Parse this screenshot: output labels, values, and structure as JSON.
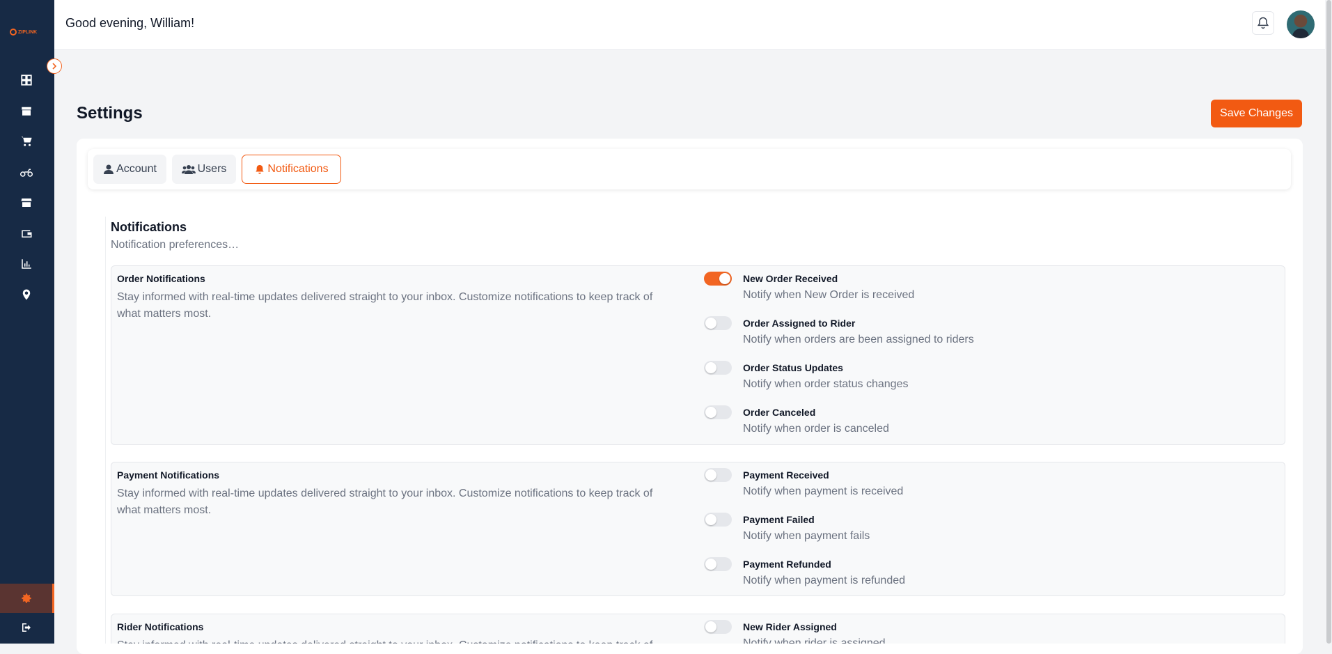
{
  "sidebar": {
    "logo_text": "ZIPLINK",
    "items": [
      {
        "icon": "dashboard-icon"
      },
      {
        "icon": "package-icon"
      },
      {
        "icon": "cart-icon"
      },
      {
        "icon": "motorbike-icon"
      },
      {
        "icon": "store-icon"
      },
      {
        "icon": "wallet-icon"
      },
      {
        "icon": "chart-icon"
      },
      {
        "icon": "location-pin-icon"
      }
    ],
    "settings_icon": "gear-icon",
    "logout_icon": "logout-icon",
    "accent": "#f26522",
    "background": "#172a45"
  },
  "header": {
    "greeting": "Good evening, William!"
  },
  "page": {
    "title": "Settings",
    "save_label": "Save Changes"
  },
  "tabs": [
    {
      "label": "Account",
      "icon": "user-icon"
    },
    {
      "label": "Users",
      "icon": "users-icon"
    },
    {
      "label": "Notifications",
      "icon": "bell-icon",
      "active": true
    }
  ],
  "notifications": {
    "title": "Notifications",
    "subtitle": "Notification preferences…",
    "groups": [
      {
        "title": "Order Notifications",
        "description": "Stay informed with real-time updates delivered straight to your inbox. Customize notifications to keep track of what matters most.",
        "options": [
          {
            "label": "New Order Received",
            "description": "Notify when New Order is received",
            "enabled": true
          },
          {
            "label": "Order Assigned to Rider",
            "description": "Notify when orders are been assigned to riders",
            "enabled": false
          },
          {
            "label": "Order Status Updates",
            "description": "Notify when order status changes",
            "enabled": false
          },
          {
            "label": "Order Canceled",
            "description": "Notify when order is canceled",
            "enabled": false
          }
        ]
      },
      {
        "title": "Payment Notifications",
        "description": "Stay informed with real-time updates delivered straight to your inbox. Customize notifications to keep track of what matters most.",
        "options": [
          {
            "label": "Payment Received",
            "description": "Notify when payment is received",
            "enabled": false
          },
          {
            "label": "Payment Failed",
            "description": "Notify when payment fails",
            "enabled": false
          },
          {
            "label": "Payment Refunded",
            "description": "Notify when payment is refunded",
            "enabled": false
          }
        ]
      },
      {
        "title": "Rider Notifications",
        "description": "Stay informed with real-time updates delivered straight to your inbox. Customize notifications to keep track of what matters most.",
        "options": [
          {
            "label": "New Rider Assigned",
            "description": "Notify when rider is assigned",
            "enabled": false
          }
        ]
      }
    ]
  }
}
